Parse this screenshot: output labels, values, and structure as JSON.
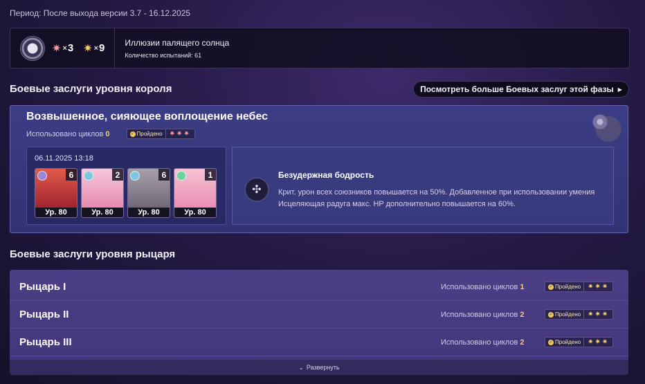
{
  "period": "Период: После выхода версии 3.7 - 16.12.2025",
  "summary": {
    "emblem_icon": "shield-eye-icon",
    "pink_count": "3",
    "gold_count": "9",
    "name": "Иллюзии палящего солнца",
    "attempts": "Количество испытаний: 61"
  },
  "king": {
    "section_title": "Боевые заслуги уровня короля",
    "more_button": "Посмотреть больше Боевых заслуг этой фазы",
    "card_title": "Возвышенное, сияющее воплощение небес",
    "cycles_label": "Использовано циклов",
    "cycles_value": "0",
    "passed_label": "Пройдено",
    "date": "06.11.2025 13:18",
    "characters": [
      {
        "eidolon": "6",
        "level": "Ур. 80",
        "element_color": "#9b86d8",
        "portrait_top": "#e25a4a",
        "portrait_bottom": "#a02430"
      },
      {
        "eidolon": "2",
        "level": "Ур. 80",
        "element_color": "#7fc7e0",
        "portrait_top": "#f6c7dc",
        "portrait_bottom": "#e58bb0"
      },
      {
        "eidolon": "6",
        "level": "Ур. 80",
        "element_color": "#7fc7e0",
        "portrait_top": "#a8a0a8",
        "portrait_bottom": "#6f6878"
      },
      {
        "eidolon": "1",
        "level": "Ур. 80",
        "element_color": "#6ed39a",
        "portrait_top": "#f7c2d4",
        "portrait_bottom": "#e88fb2"
      }
    ],
    "buff_icon": "wind-wheel-icon",
    "buff_title": "Безудержная бодрость",
    "buff_desc": "Крит. урон всех союзников повышается на 50%. Добавленное при использовании умения Исцеляющая радуга макс. HP дополнительно повышается на 60%."
  },
  "knight": {
    "section_title": "Боевые заслуги уровня рыцаря",
    "cycles_label": "Использовано циклов",
    "passed_label": "Пройдено",
    "rows": [
      {
        "name": "Рыцарь I",
        "cycles": "1"
      },
      {
        "name": "Рыцарь II",
        "cycles": "2"
      },
      {
        "name": "Рыцарь III",
        "cycles": "2"
      }
    ],
    "expand_label": "Развернуть"
  },
  "colors": {
    "gold": "#f4cd6a",
    "pink_star": "#ff9b9b",
    "card_blue": "#3c3d86",
    "card_purple": "#4d3f86"
  }
}
